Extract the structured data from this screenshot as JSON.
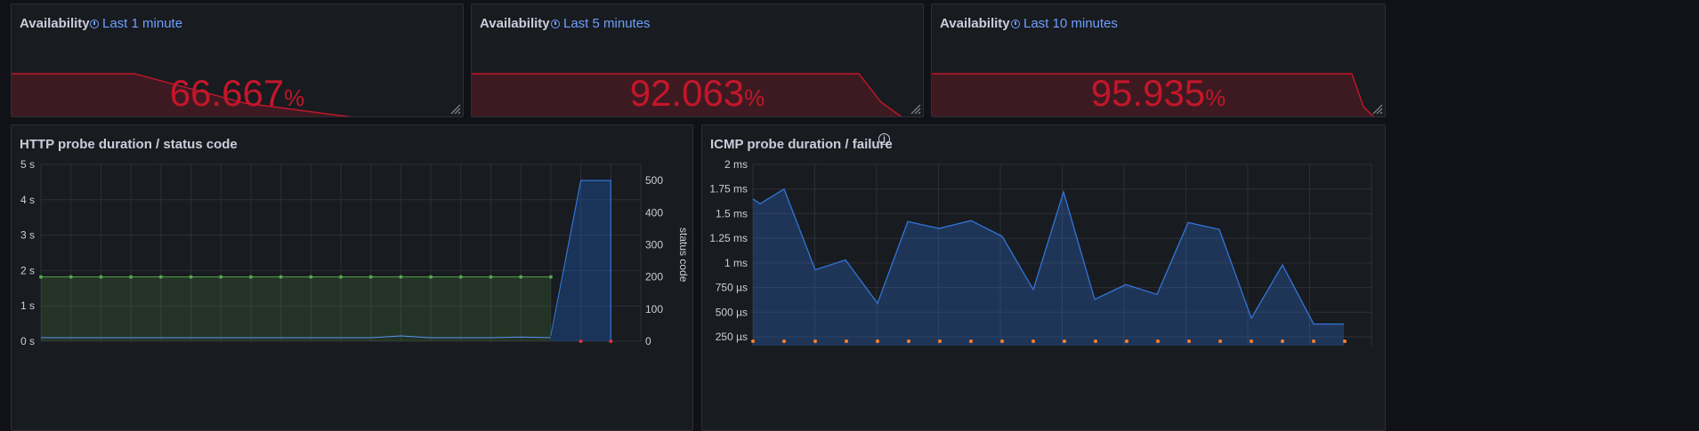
{
  "stats": [
    {
      "title": "Availability",
      "time": "Last 1 minute",
      "value": "66.667",
      "unit": "%"
    },
    {
      "title": "Availability",
      "time": "Last 5 minutes",
      "value": "92.063",
      "unit": "%"
    },
    {
      "title": "Availability",
      "time": "Last 10 minutes",
      "value": "95.935",
      "unit": "%"
    }
  ],
  "http": {
    "title": "HTTP probe duration / status code",
    "left_ticks": [
      "5 s",
      "4 s",
      "3 s",
      "2 s",
      "1 s",
      "0 s"
    ],
    "right_ticks": [
      "500",
      "400",
      "300",
      "200",
      "100",
      "0"
    ],
    "right_label": "status code"
  },
  "icmp": {
    "title": "ICMP probe duration / failure",
    "ticks": [
      "2 ms",
      "1.75 ms",
      "1.5 ms",
      "1.25 ms",
      "1 ms",
      "750 µs",
      "500 µs",
      "250 µs"
    ]
  },
  "colors": {
    "stat_red": "#c4162a",
    "http_green": "#56a64b",
    "http_blue": "#1f60c4",
    "icmp_blue": "#3274d9",
    "failure_orange": "#ff7f2a",
    "link_blue": "#6e9fff"
  },
  "chart_data": [
    {
      "type": "area",
      "title": "Availability",
      "x": [
        0,
        1,
        2,
        3
      ],
      "values": [
        100,
        100,
        66.667,
        66.667
      ],
      "ylim": [
        0,
        100
      ]
    },
    {
      "type": "area",
      "title": "Availability",
      "x": [
        0,
        1,
        2,
        3
      ],
      "values": [
        100,
        100,
        92.063,
        92.063
      ],
      "ylim": [
        0,
        100
      ]
    },
    {
      "type": "area",
      "title": "Availability",
      "x": [
        0,
        1,
        2,
        3
      ],
      "values": [
        100,
        100,
        95.935,
        95.935
      ],
      "ylim": [
        0,
        100
      ]
    },
    {
      "type": "area",
      "title": "HTTP probe duration / status code",
      "ylim": [
        0,
        5
      ],
      "y2lim": [
        0,
        550
      ],
      "y2label": "status code",
      "series": [
        {
          "name": "",
          "axis": "right",
          "values": [
            200,
            200,
            200,
            200,
            200,
            200,
            200,
            200,
            200,
            200,
            200,
            200,
            200,
            200,
            200,
            200,
            200,
            200,
            0,
            0,
            0
          ]
        },
        {
          "name": "",
          "axis": "left",
          "values": [
            0.1,
            0.1,
            0.1,
            0.1,
            0.1,
            0.1,
            0.1,
            0.1,
            0.1,
            0.1,
            0.1,
            0.1,
            0.15,
            0.1,
            0.1,
            0.1,
            0.12,
            0.1,
            0.08,
            0.1,
            0.15,
            4.5,
            4.5
          ]
        },
        {
          "name": "",
          "axis": "right",
          "values": [
            500,
            500
          ]
        }
      ]
    },
    {
      "type": "area",
      "title": "ICMP probe duration / failure",
      "ylim": [
        0.25,
        2
      ],
      "ylabel": "",
      "series": [
        {
          "name": "",
          "values": [
            1.65,
            1.6,
            1.75,
            0.93,
            1.03,
            0.59,
            1.42,
            1.35,
            1.43,
            1.27,
            0.73,
            1.72,
            0.63,
            0.78,
            0.68,
            1.41,
            1.34,
            0.44,
            0.98,
            0.38,
            0.38
          ]
        }
      ]
    }
  ]
}
